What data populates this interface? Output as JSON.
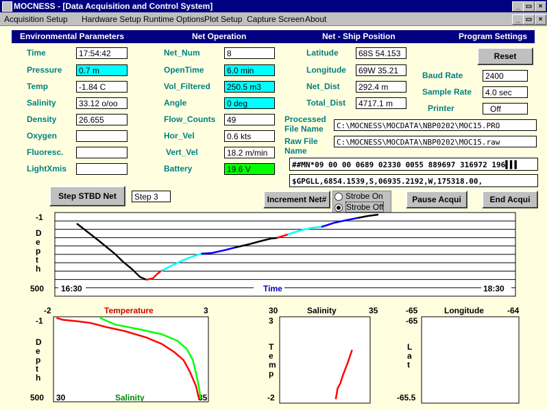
{
  "window": {
    "title": "MOCNESS - [Data Acquisition and Control System]"
  },
  "menu": [
    "Acquisition Setup",
    "Hardware Setup",
    "Runtime Options",
    "Plot Setup",
    "Capture Screen",
    "About"
  ],
  "headers": {
    "env": "Environmental Parameters",
    "net": "Net Operation",
    "ship": "Net - Ship Position",
    "prog": "Program Settings"
  },
  "env": {
    "time": {
      "label": "Time",
      "value": "17:54:42"
    },
    "pressure": {
      "label": "Pressure",
      "value": "0.7 m"
    },
    "temp": {
      "label": "Temp",
      "value": "-1.84 C"
    },
    "salinity": {
      "label": "Salinity",
      "value": "33.12 o/oo"
    },
    "density": {
      "label": "Density",
      "value": "26.655"
    },
    "oxygen": {
      "label": "Oxygen",
      "value": ""
    },
    "fluoresc": {
      "label": "Fluoresc.",
      "value": ""
    },
    "lightxmis": {
      "label": "LightXmis",
      "value": ""
    }
  },
  "net": {
    "net_num": {
      "label": "Net_Num",
      "value": "8"
    },
    "opentime": {
      "label": "OpenTime",
      "value": "6.0 min"
    },
    "vol": {
      "label": "Vol_Filtered",
      "value": "250.5 m3"
    },
    "angle": {
      "label": "Angle",
      "value": "0 deg"
    },
    "flow": {
      "label": "Flow_Counts",
      "value": "49"
    },
    "horvel": {
      "label": "Hor_Vel",
      "value": "0.6 kts"
    },
    "vertvel": {
      "label": "Vert_Vel",
      "value": "18.2 m/min"
    },
    "battery": {
      "label": "Battery",
      "value": "19.6 V"
    }
  },
  "ship": {
    "lat": {
      "label": "Latitude",
      "value": "68S 54.153"
    },
    "lon": {
      "label": "Longitude",
      "value": "69W 35.21"
    },
    "netdist": {
      "label": "Net_Dist",
      "value": "292.4 m"
    },
    "totaldist": {
      "label": "Total_Dist",
      "value": "4717.1 m"
    }
  },
  "prog": {
    "reset": "Reset",
    "baud": {
      "label": "Baud Rate",
      "value": "2400"
    },
    "sample": {
      "label": "Sample Rate",
      "value": "4.0 sec"
    },
    "printer": {
      "label": "Printer",
      "value": "Off"
    }
  },
  "files": {
    "processed_label": "Processed File Name",
    "processed": "C:\\MOCNESS\\MOCDATA\\NBP0202\\MOC15.PRO",
    "raw_label": "Raw File Name",
    "raw": "C:\\MOCNESS\\MOCDATA\\NBP0202\\MOC15.raw"
  },
  "streams": {
    "mn": "##MN*09 00 00 0689 02330 0055 889697 316972 196▌▌▌",
    "gpgll": "$GPGLL,6854.1539,S,06935.2192,W,175318.00,"
  },
  "controls": {
    "step_button": "Step STBD Net",
    "step_value": "Step 3",
    "increment": "Increment Net#",
    "strobe_on": "Strobe On",
    "strobe_off": "Strobe Off",
    "pause": "Pause Acqui",
    "end": "End Acqui"
  },
  "colors": {
    "header": "#000080",
    "label": "#008080",
    "highlight": "#00ffff",
    "battery": "#00ff00"
  },
  "chart_data": [
    {
      "type": "line",
      "title": "",
      "xlabel": "Time",
      "ylabel": "Depth",
      "x_start_label": "16:30",
      "x_end_label": "18:30",
      "y_top_label": "-1",
      "y_bottom_label": "500",
      "xlim": [
        0,
        120
      ],
      "ylim": [
        500,
        -1
      ],
      "grid": true,
      "series": [
        {
          "color": "#000000",
          "points": [
            [
              0,
              70
            ],
            [
              5,
              130
            ],
            [
              10,
              190
            ],
            [
              14,
              240
            ],
            [
              18,
              290
            ],
            [
              22,
              350
            ],
            [
              26,
              400
            ],
            [
              30,
              460
            ],
            [
              33,
              480
            ]
          ]
        },
        {
          "color": "#ff0000",
          "points": [
            [
              33,
              480
            ],
            [
              36,
              470
            ],
            [
              38,
              440
            ],
            [
              40,
              415
            ]
          ]
        },
        {
          "color": "#00ffff",
          "points": [
            [
              40,
              415
            ],
            [
              44,
              385
            ],
            [
              50,
              340
            ],
            [
              55,
              310
            ],
            [
              59,
              290
            ]
          ]
        },
        {
          "color": "#0000ff",
          "points": [
            [
              59,
              290
            ],
            [
              64,
              285
            ],
            [
              70,
              265
            ],
            [
              75,
              245
            ]
          ]
        },
        {
          "color": "#000000",
          "points": [
            [
              75,
              245
            ],
            [
              82,
              220
            ],
            [
              88,
              195
            ],
            [
              92,
              180
            ],
            [
              95,
              175
            ]
          ]
        },
        {
          "color": "#ff0000",
          "points": [
            [
              95,
              175
            ],
            [
              98,
              160
            ],
            [
              100,
              150
            ]
          ]
        },
        {
          "color": "#00ffff",
          "points": [
            [
              100,
              150
            ],
            [
              106,
              120
            ],
            [
              112,
              100
            ],
            [
              116,
              95
            ]
          ]
        },
        {
          "color": "#0000ff",
          "points": [
            [
              116,
              95
            ],
            [
              122,
              65
            ],
            [
              128,
              45
            ],
            [
              133,
              30
            ]
          ]
        },
        {
          "color": "#000000",
          "points": [
            [
              133,
              30
            ],
            [
              138,
              15
            ],
            [
              143,
              5
            ]
          ]
        }
      ]
    },
    {
      "type": "line",
      "title": "Temperature",
      "xlabel": "Salinity",
      "ylabel": "Depth",
      "x_top_range": [
        "-2",
        "3"
      ],
      "x_bottom_range": [
        "30",
        "35"
      ],
      "y_top_label": "-1",
      "y_bottom_label": "500",
      "series": [
        {
          "name": "Temperature",
          "color": "#ff0000",
          "points": [
            [
              -1.9,
              -1
            ],
            [
              -1.7,
              10
            ],
            [
              -1.2,
              20
            ],
            [
              -0.8,
              30
            ],
            [
              -0.3,
              55
            ],
            [
              0.3,
              80
            ],
            [
              1.0,
              120
            ],
            [
              1.5,
              160
            ],
            [
              1.9,
              210
            ],
            [
              2.2,
              260
            ],
            [
              2.4,
              330
            ],
            [
              2.6,
              420
            ],
            [
              2.7,
              500
            ]
          ]
        },
        {
          "name": "Salinity",
          "color": "#00ff00",
          "points": [
            [
              31.5,
              -1
            ],
            [
              32.0,
              40
            ],
            [
              32.8,
              70
            ],
            [
              33.5,
              100
            ],
            [
              34.0,
              140
            ],
            [
              34.3,
              190
            ],
            [
              34.5,
              260
            ],
            [
              34.6,
              340
            ],
            [
              34.7,
              430
            ],
            [
              34.75,
              500
            ]
          ]
        }
      ]
    },
    {
      "type": "line",
      "title": "Salinity",
      "xlabel": "",
      "ylabel": "Temp",
      "x_range": [
        "30",
        "35"
      ],
      "y_top_label": "3",
      "y_bottom_label": "-2",
      "series": [
        {
          "color": "#ff0000",
          "points": [
            [
              33.1,
              -1.85
            ],
            [
              33.2,
              -1.2
            ],
            [
              33.35,
              -0.9
            ],
            [
              33.5,
              -0.4
            ],
            [
              33.75,
              0.3
            ],
            [
              34.0,
              1.1
            ]
          ]
        }
      ]
    },
    {
      "type": "scatter",
      "title": "Longitude",
      "xlabel": "",
      "ylabel": "Lat",
      "x_range": [
        "-65",
        "-64"
      ],
      "y_top_label": "-65",
      "y_bottom_label": "-65.5",
      "series": []
    }
  ]
}
